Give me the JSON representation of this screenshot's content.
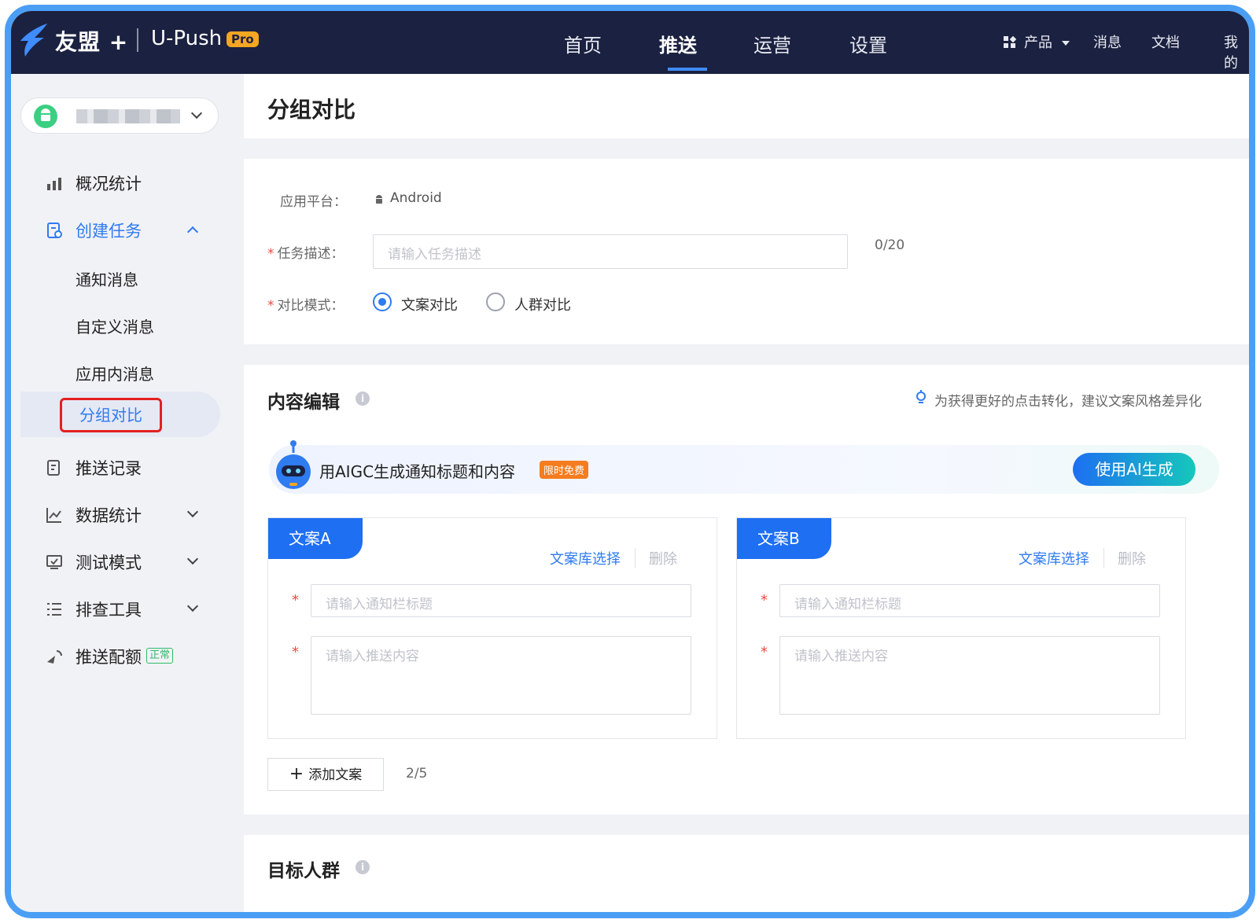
{
  "topbar": {
    "brand": "友盟 +",
    "product": "U-Push",
    "pro_badge": "Pro",
    "nav": [
      "首页",
      "推送",
      "运营",
      "设置"
    ],
    "nav_active": "推送",
    "right_nav": {
      "products": "产品",
      "messages": "消息",
      "docs": "文档",
      "me": "我的"
    }
  },
  "sidebar": {
    "items": [
      {
        "label": "概况统计",
        "icon": "bar-chart-icon"
      },
      {
        "label": "创建任务",
        "icon": "create-task-icon",
        "expanded": true
      },
      {
        "label": "推送记录",
        "icon": "push-record-icon"
      },
      {
        "label": "数据统计",
        "icon": "line-chart-icon"
      },
      {
        "label": "测试模式",
        "icon": "test-monitor-icon"
      },
      {
        "label": "排查工具",
        "icon": "list-tool-icon"
      },
      {
        "label": "推送配额",
        "icon": "send-icon",
        "badge": "正常"
      }
    ],
    "sub_items": [
      "通知消息",
      "自定义消息",
      "应用内消息",
      "分组对比"
    ],
    "sub_active": "分组对比"
  },
  "page": {
    "title": "分组对比"
  },
  "form": {
    "platform_label": "应用平台：",
    "platform_value": "Android",
    "task_desc_label": "任务描述：",
    "task_desc_placeholder": "请输入任务描述",
    "task_desc_counter": "0/20",
    "compare_mode_label": "对比模式：",
    "compare_modes": [
      "文案对比",
      "人群对比"
    ],
    "compare_mode_selected": "文案对比"
  },
  "content_edit": {
    "title": "内容编辑",
    "tip": "为获得更好的点击转化，建议文案风格差异化",
    "aigc_text": "用AIGC生成通知标题和内容",
    "aigc_free": "限时免费",
    "aigc_button": "使用AI生成",
    "copies": [
      {
        "tab": "文案A",
        "library": "文案库选择",
        "delete": "删除",
        "title_placeholder": "请输入通知栏标题",
        "content_placeholder": "请输入推送内容"
      },
      {
        "tab": "文案B",
        "library": "文案库选择",
        "delete": "删除",
        "title_placeholder": "请输入通知栏标题",
        "content_placeholder": "请输入推送内容"
      }
    ],
    "add_copy": "添加文案",
    "copy_count": "2/5"
  },
  "target": {
    "title": "目标人群"
  },
  "colors": {
    "primary": "#2f7bf0",
    "nav_bg": "#1b2140",
    "alert_red": "#e32020",
    "frame": "#4a9ff5"
  }
}
